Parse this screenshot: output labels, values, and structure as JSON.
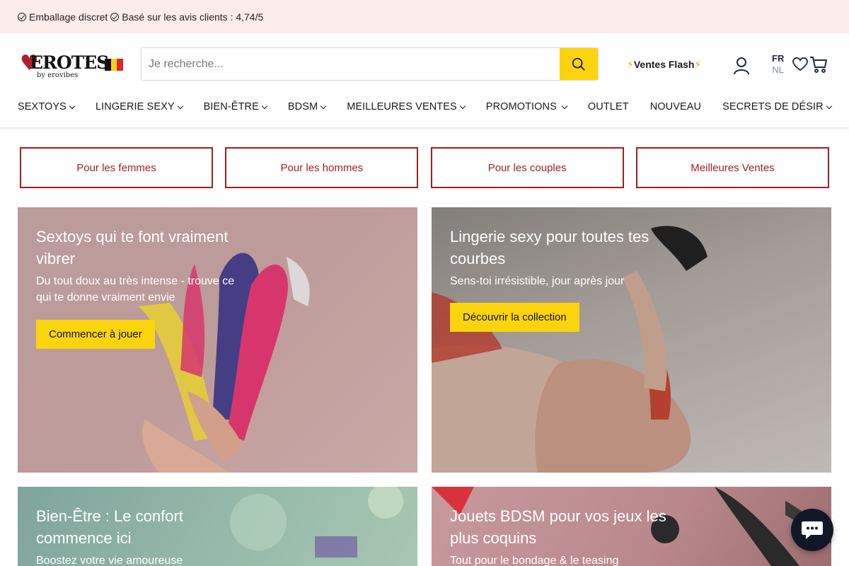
{
  "topbar": {
    "usp1": "Emballage discret",
    "usp2": "Basé sur les avis clients : 4,74/5"
  },
  "header": {
    "logo_text": "EROTES",
    "logo_sub": "by erovibes",
    "flag_colors": [
      "#111111",
      "#f7d117",
      "#e0262b"
    ],
    "search_placeholder": "Je recherche...",
    "flash_label": "Ventes Flash",
    "flash_icon": "⚡",
    "lang_active": "FR",
    "lang_other": "NL",
    "icons": [
      "search-icon",
      "account-icon",
      "heart-icon",
      "cart-icon"
    ]
  },
  "nav": {
    "items": [
      {
        "label": "SEXTOYS",
        "dropdown": true
      },
      {
        "label": "LINGERIE SEXY",
        "dropdown": true
      },
      {
        "label": "BIEN-ÊTRE",
        "dropdown": true
      },
      {
        "label": "BDSM",
        "dropdown": true
      },
      {
        "label": "MEILLEURES VENTES",
        "dropdown": true
      },
      {
        "label": "PROMOTIONS",
        "dropdown": true
      },
      {
        "label": "OUTLET",
        "dropdown": false
      },
      {
        "label": "NOUVEAU",
        "dropdown": false
      },
      {
        "label": "SECRETS DE DÉSIR",
        "dropdown": true
      }
    ]
  },
  "categories": [
    "Pour les femmes",
    "Pour les hommes",
    "Pour les couples",
    "Meilleures Ventes"
  ],
  "tiles": {
    "sextoys": {
      "title": "Sextoys qui te font vraiment vibrer",
      "subtitle": "Du tout doux au très intense - trouve ce qui te donne vraiment envie",
      "cta": "Commencer à jouer"
    },
    "lingerie": {
      "title": "Lingerie sexy pour toutes tes courbes",
      "subtitle": "Sens-toi irrésistible, jour après jour",
      "cta": "Découvrir la collection"
    },
    "wellbeing": {
      "title": "Bien-Être : Le confort commence ici",
      "subtitle": "Boostez votre vie amoureuse"
    },
    "bdsm": {
      "title": "Jouets BDSM pour vos jeux les plus coquins",
      "subtitle": "Tout pour le bondage & le teasing"
    }
  },
  "colors": {
    "accent_yellow": "#fbd40e",
    "brand_red": "#9c1f1f",
    "topbar_bg": "#fdecec",
    "chat_bg": "#101828"
  }
}
